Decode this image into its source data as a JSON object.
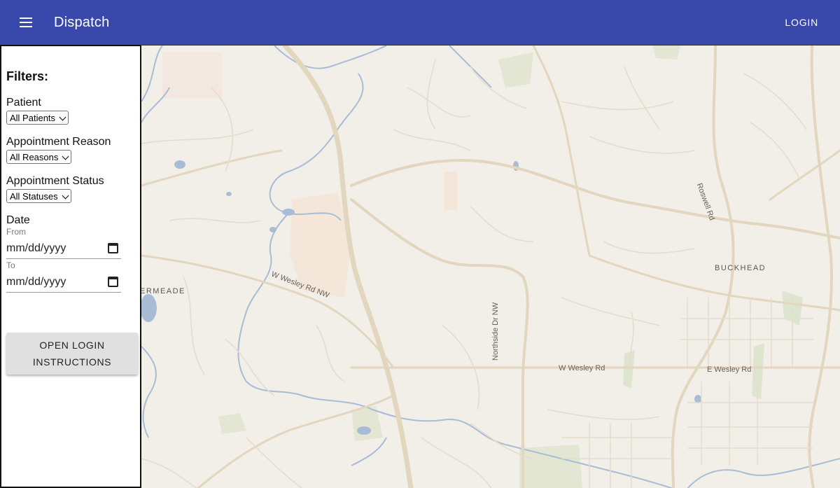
{
  "appbar": {
    "title": "Dispatch",
    "login_label": "LOGIN"
  },
  "sidebar": {
    "filters_title": "Filters:",
    "patient": {
      "label": "Patient",
      "selected": "All Patients"
    },
    "reason": {
      "label": "Appointment Reason",
      "selected": "All Reasons"
    },
    "status": {
      "label": "Appointment Status",
      "selected": "All Statuses"
    },
    "date": {
      "label": "Date",
      "from_label": "From",
      "from_placeholder": "mm/dd/yyyy",
      "to_label": "To",
      "to_placeholder": "mm/dd/yyyy"
    },
    "open_login_instructions": "OPEN LOGIN INSTRUCTIONS"
  },
  "map": {
    "labels": {
      "w_wesley_nw": "W Wesley Rd NW",
      "northside": "Northside Dr NW",
      "w_wesley": "W Wesley Rd",
      "e_wesley": "E Wesley Rd",
      "roswell": "Roswell Rd",
      "buckhead": "BUCKHEAD",
      "ermeade": "ERMEADE"
    }
  },
  "colors": {
    "appbar": "#3949ab",
    "map_bg": "#f1efe8",
    "road": "#e3d6be",
    "water": "#a9bcd6"
  }
}
